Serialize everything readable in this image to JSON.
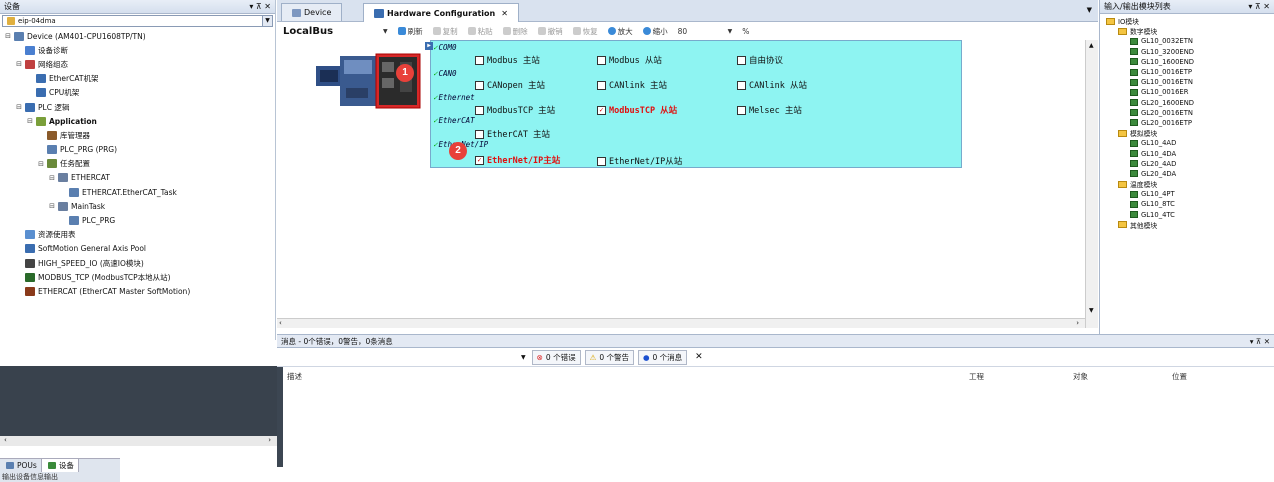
{
  "left_panel": {
    "title": "设备",
    "pin": "▾ ⊼ ✕",
    "project": "eip-04dma",
    "tree": [
      {
        "label": "Device (AM401-CPU1608TP/TN)",
        "depth": 0,
        "exp": "⊟",
        "color": "#5a7fb0"
      },
      {
        "label": "设备诊断",
        "depth": 1,
        "exp": "",
        "color": "#4a7fd0"
      },
      {
        "label": "网络组态",
        "depth": 1,
        "exp": "⊟",
        "color": "#c04040"
      },
      {
        "label": "EtherCAT机架",
        "depth": 2,
        "exp": "",
        "color": "#3a6db0"
      },
      {
        "label": "CPU机架",
        "depth": 2,
        "exp": "",
        "color": "#3a6db0"
      },
      {
        "label": "PLC 逻辑",
        "depth": 1,
        "exp": "⊟",
        "color": "#3a6db0"
      },
      {
        "label": "Application",
        "depth": 2,
        "exp": "⊟",
        "color": "#7a9f3a",
        "bold": true
      },
      {
        "label": "库管理器",
        "depth": 3,
        "exp": "",
        "color": "#8a5a2a"
      },
      {
        "label": "PLC_PRG (PRG)",
        "depth": 3,
        "exp": "",
        "color": "#5a7fb0"
      },
      {
        "label": "任务配置",
        "depth": 3,
        "exp": "⊟",
        "color": "#6a8a3a"
      },
      {
        "label": "ETHERCAT",
        "depth": 4,
        "exp": "⊟",
        "color": "#6a7fa0"
      },
      {
        "label": "ETHERCAT.EtherCAT_Task",
        "depth": 5,
        "exp": "",
        "color": "#5a7fb0"
      },
      {
        "label": "MainTask",
        "depth": 4,
        "exp": "⊟",
        "color": "#6a7fa0"
      },
      {
        "label": "PLC_PRG",
        "depth": 5,
        "exp": "",
        "color": "#5a7fb0"
      },
      {
        "label": "资源使用表",
        "depth": 1,
        "exp": "",
        "color": "#5a8fd0"
      },
      {
        "label": "SoftMotion General Axis Pool",
        "depth": 1,
        "exp": "",
        "color": "#3a6db0"
      },
      {
        "label": "HIGH_SPEED_IO (高速IO模块)",
        "depth": 1,
        "exp": "",
        "color": "#444"
      },
      {
        "label": "MODBUS_TCP (ModbusTCP本地从站)",
        "depth": 1,
        "exp": "",
        "color": "#2a6a2a"
      },
      {
        "label": "ETHERCAT (EtherCAT Master SoftMotion)",
        "depth": 1,
        "exp": "",
        "color": "#8a3a1a"
      }
    ]
  },
  "tabs": [
    {
      "label": "Device"
    },
    {
      "label": "Hardware Configuration",
      "close": "✕"
    }
  ],
  "toolbar": {
    "bus": "LocalBus",
    "refresh": "刷新",
    "copy": "复制",
    "paste": "粘贴",
    "delete": "删除",
    "undo": "撤销",
    "redo": "恢复",
    "zoom_in": "放大",
    "zoom_out": "缩小",
    "zoom": "80",
    "percent": "%"
  },
  "config": {
    "groups": [
      "COM0",
      "CAN0",
      "Ethernet",
      "EtherCAT",
      "EtherNet/IP"
    ],
    "options": {
      "modbus_master": {
        "label": "Modbus 主站",
        "checked": false
      },
      "modbus_slave": {
        "label": "Modbus 从站",
        "checked": false
      },
      "free_protocol": {
        "label": "自由协议",
        "checked": false
      },
      "canopen_master": {
        "label": "CANopen 主站",
        "checked": false
      },
      "canlink_master": {
        "label": "CANlink 主站",
        "checked": false
      },
      "canlink_slave": {
        "label": "CANlink 从站",
        "checked": false
      },
      "modbustcp_master": {
        "label": "ModbusTCP 主站",
        "checked": false
      },
      "modbustcp_slave": {
        "label": "ModbusTCP 从站",
        "checked": true
      },
      "melsec_master": {
        "label": "Melsec 主站",
        "checked": false
      },
      "ethercat_master": {
        "label": "EtherCAT 主站",
        "checked": false
      },
      "eip_master": {
        "label": "EtherNet/IP主站",
        "checked": true
      },
      "eip_slave": {
        "label": "EtherNet/IP从站",
        "checked": false
      }
    },
    "badges": [
      "1",
      "2"
    ]
  },
  "right_panel": {
    "title": "输入/输出模块列表",
    "pin": "▾ ⊼ ✕",
    "tree": [
      {
        "label": "IO模块",
        "depth": 0,
        "type": "folder"
      },
      {
        "label": "数字模块",
        "depth": 1,
        "type": "folder"
      },
      {
        "label": "GL10_0032ETN",
        "depth": 2,
        "type": "mod"
      },
      {
        "label": "GL10_3200END",
        "depth": 2,
        "type": "mod"
      },
      {
        "label": "GL10_1600END",
        "depth": 2,
        "type": "mod"
      },
      {
        "label": "GL10_0016ETP",
        "depth": 2,
        "type": "mod"
      },
      {
        "label": "GL10_0016ETN",
        "depth": 2,
        "type": "mod"
      },
      {
        "label": "GL10_0016ER",
        "depth": 2,
        "type": "mod"
      },
      {
        "label": "GL20_1600END",
        "depth": 2,
        "type": "mod"
      },
      {
        "label": "GL20_0016ETN",
        "depth": 2,
        "type": "mod"
      },
      {
        "label": "GL20_0016ETP",
        "depth": 2,
        "type": "mod"
      },
      {
        "label": "模拟模块",
        "depth": 1,
        "type": "folder"
      },
      {
        "label": "GL10_4AD",
        "depth": 2,
        "type": "mod"
      },
      {
        "label": "GL10_4DA",
        "depth": 2,
        "type": "mod"
      },
      {
        "label": "GL20_4AD",
        "depth": 2,
        "type": "mod"
      },
      {
        "label": "GL20_4DA",
        "depth": 2,
        "type": "mod"
      },
      {
        "label": "温度模块",
        "depth": 1,
        "type": "folder"
      },
      {
        "label": "GL10_4PT",
        "depth": 2,
        "type": "mod"
      },
      {
        "label": "GL10_8TC",
        "depth": 2,
        "type": "mod"
      },
      {
        "label": "GL10_4TC",
        "depth": 2,
        "type": "mod"
      },
      {
        "label": "其他模块",
        "depth": 1,
        "type": "folder"
      }
    ]
  },
  "messages": {
    "title": "消息 - 0个错误，0警告，0条消息",
    "pin": "▾ ⊼ ✕",
    "errors": "0 个错误",
    "warnings": "0 个警告",
    "infos": "0 个消息",
    "columns": [
      "描述",
      "工程",
      "对象",
      "位置"
    ]
  },
  "bottom": {
    "tabs": [
      "POUs",
      "设备"
    ],
    "status": "输出设备信息输出"
  }
}
